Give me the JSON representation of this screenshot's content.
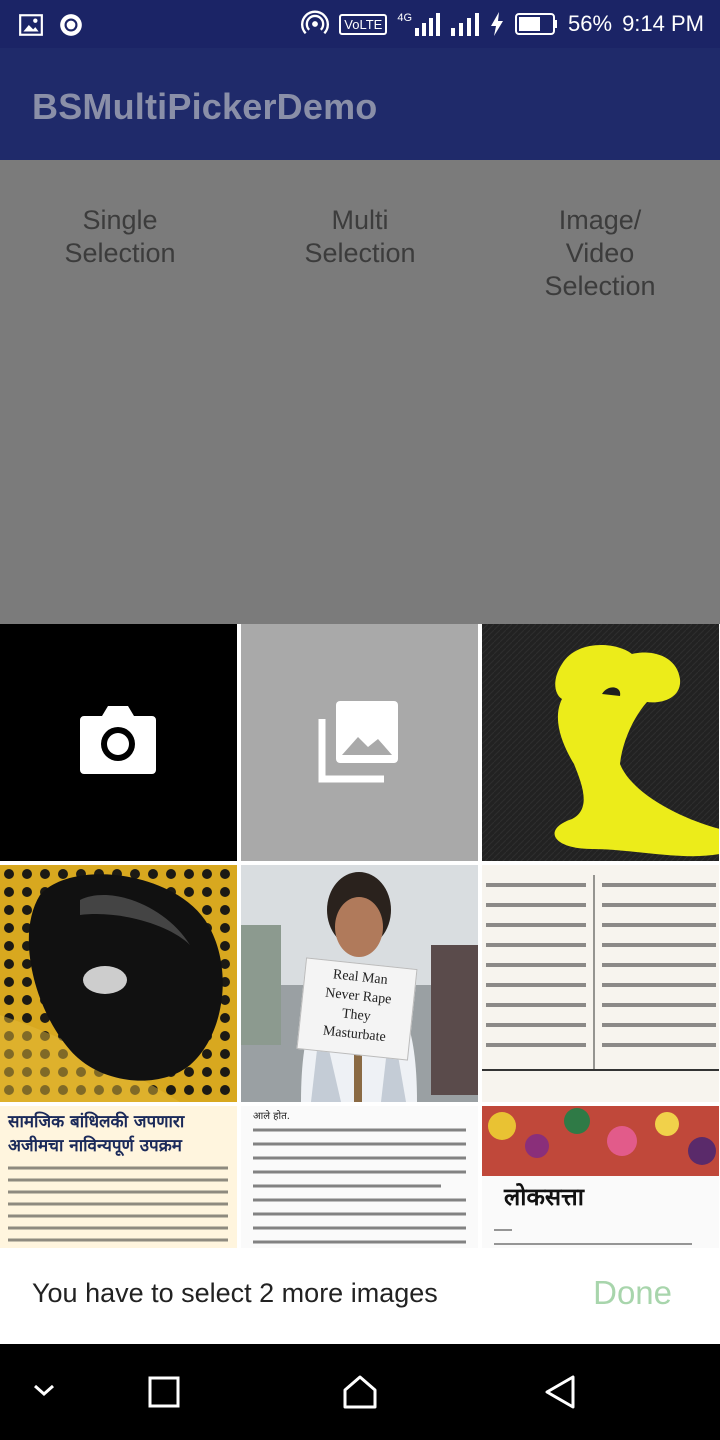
{
  "status_bar": {
    "left_icons": [
      "image-icon",
      "record-icon"
    ],
    "network": "4G",
    "volte": "VoLTE",
    "battery": "56%",
    "time": "9:14 PM"
  },
  "app_bar": {
    "title": "BSMultiPickerDemo"
  },
  "modes": [
    {
      "label": "Single\nSelection"
    },
    {
      "label": "Multi\nSelection"
    },
    {
      "label": "Image/\nVideo\nSelection"
    }
  ],
  "picker": {
    "tiles": [
      {
        "kind": "camera",
        "icon": "camera-icon"
      },
      {
        "kind": "gallery",
        "icon": "gallery-icon"
      },
      {
        "kind": "photo",
        "subject": "yellow figure on black fabric"
      },
      {
        "kind": "photo",
        "subject": "black computer mouse on patterned cloth"
      },
      {
        "kind": "photo",
        "subject": "man holding protest sign",
        "sign_text": [
          "Real Man",
          "Never Rape",
          "They",
          "Masturbate"
        ]
      },
      {
        "kind": "photo",
        "subject": "newspaper clipping columns"
      },
      {
        "kind": "photo",
        "subject": "newspaper article",
        "headline": [
          "सामजिक बांधिलकी जपणारा",
          "अजीमचा नाविन्यपूर्ण उपक्रम"
        ]
      },
      {
        "kind": "photo",
        "subject": "newspaper text block",
        "lead": "आले होत."
      },
      {
        "kind": "photo",
        "subject": "Loksatta newspaper",
        "masthead": "लोकसत्ता"
      }
    ],
    "hint": "You have to select 2 more images",
    "done_label": "Done"
  },
  "nav_bar": {
    "buttons": [
      "chevron-down-icon",
      "square-icon",
      "home-icon",
      "back-icon"
    ]
  }
}
